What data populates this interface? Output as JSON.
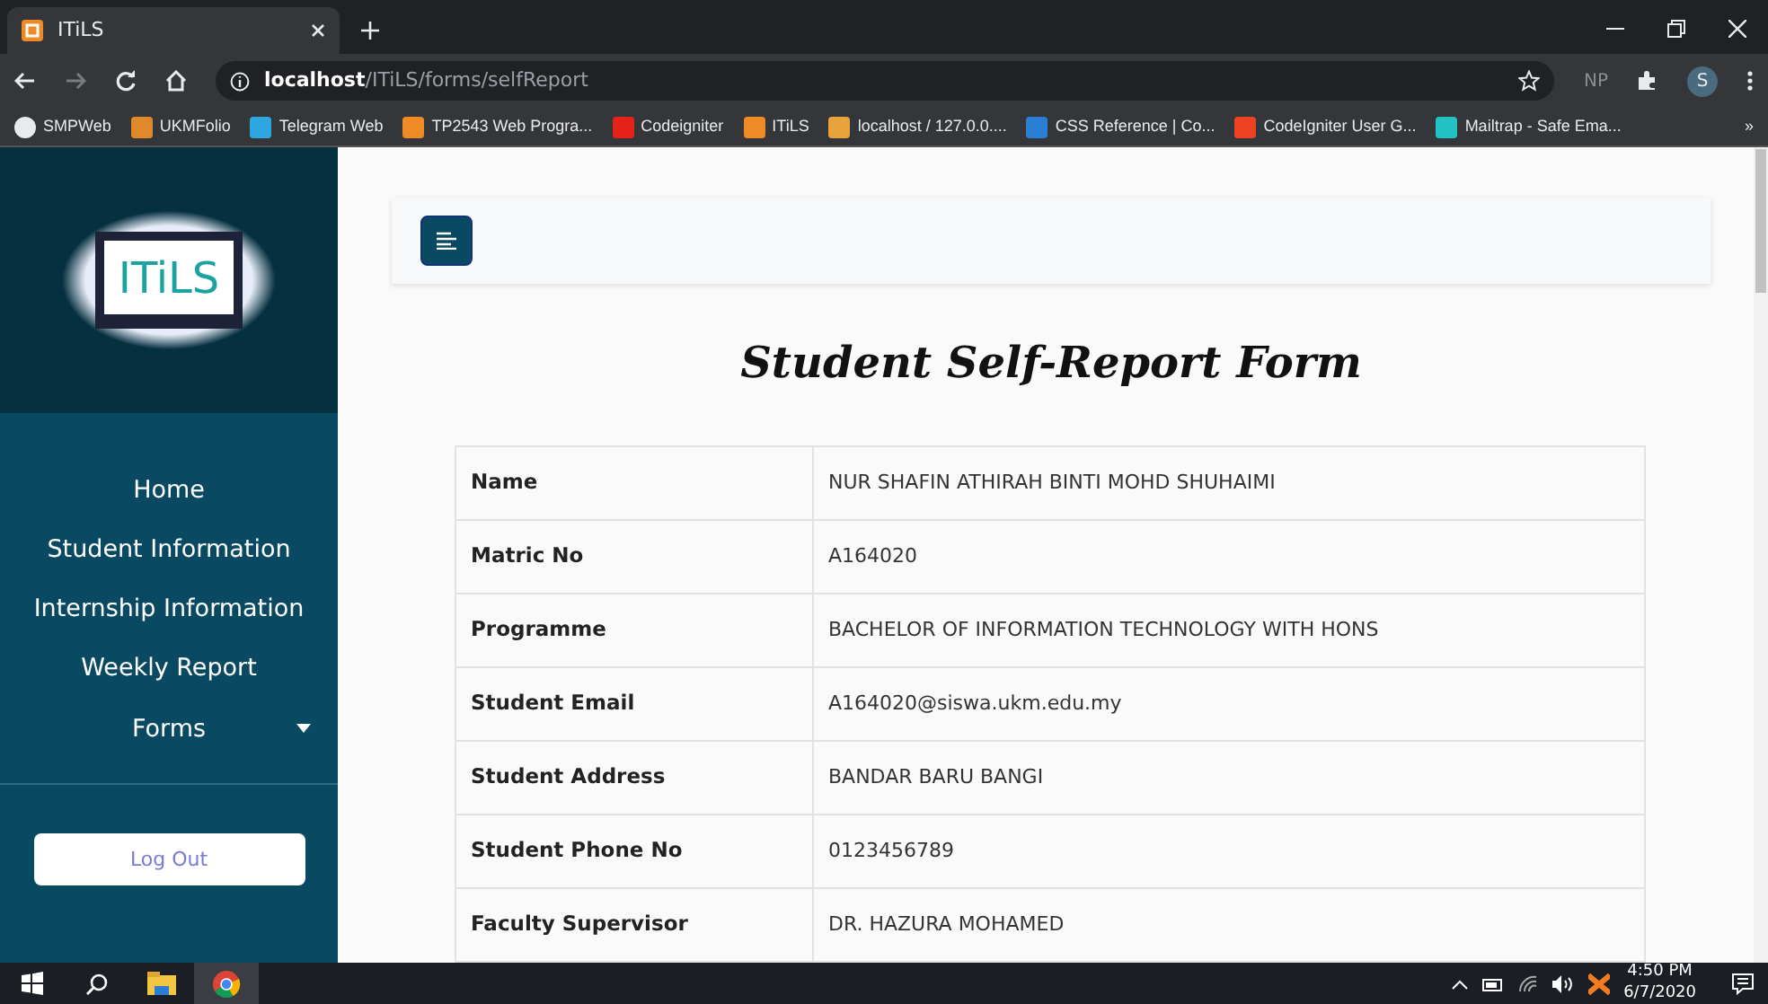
{
  "browser": {
    "tab": {
      "title": "ITiLS",
      "selected": true
    },
    "address": {
      "host": "localhost",
      "path": "/ITiLS/forms/selfReport"
    },
    "profile_initial": "S",
    "extension_label": "NP",
    "bookmarks": [
      {
        "label": "SMPWeb",
        "color": "#e8eaed"
      },
      {
        "label": "UKMFolio",
        "color": "#e0892a"
      },
      {
        "label": "Telegram Web",
        "color": "#2ea6df"
      },
      {
        "label": "TP2543 Web Progra...",
        "color": "#f08a24"
      },
      {
        "label": "Codeigniter",
        "color": "#e62117"
      },
      {
        "label": "ITiLS",
        "color": "#f08a24"
      },
      {
        "label": "localhost / 127.0.0....",
        "color": "#e8a33d"
      },
      {
        "label": "CSS Reference | Co...",
        "color": "#2a7fd4"
      },
      {
        "label": "CodeIgniter User G...",
        "color": "#ee4323"
      },
      {
        "label": "Mailtrap - Safe Ema...",
        "color": "#22c1c3"
      }
    ],
    "more": "»"
  },
  "sidebar": {
    "logo_text": "ITiLS",
    "items": [
      {
        "label": "Home",
        "kind": "link"
      },
      {
        "label": "Student Information",
        "kind": "link"
      },
      {
        "label": "Internship Information",
        "kind": "link"
      },
      {
        "label": "Weekly Report",
        "kind": "link"
      },
      {
        "label": "Forms",
        "kind": "dropdown",
        "expanded": false
      }
    ],
    "logout": "Log Out"
  },
  "page": {
    "title": "Student Self-Report Form",
    "rows": [
      {
        "label": "Name",
        "value": "NUR SHAFIN ATHIRAH BINTI MOHD SHUHAIMI"
      },
      {
        "label": "Matric No",
        "value": "A164020"
      },
      {
        "label": "Programme",
        "value": "BACHELOR OF INFORMATION TECHNOLOGY WITH HONS"
      },
      {
        "label": "Student Email",
        "value": "A164020@siswa.ukm.edu.my"
      },
      {
        "label": "Student Address",
        "value": "BANDAR BARU BANGI"
      },
      {
        "label": "Student Phone No",
        "value": "0123456789"
      },
      {
        "label": "Faculty Supervisor",
        "value": "DR. HAZURA MOHAMED"
      }
    ]
  },
  "taskbar": {
    "time": "4:50 PM",
    "date": "6/7/2020"
  }
}
